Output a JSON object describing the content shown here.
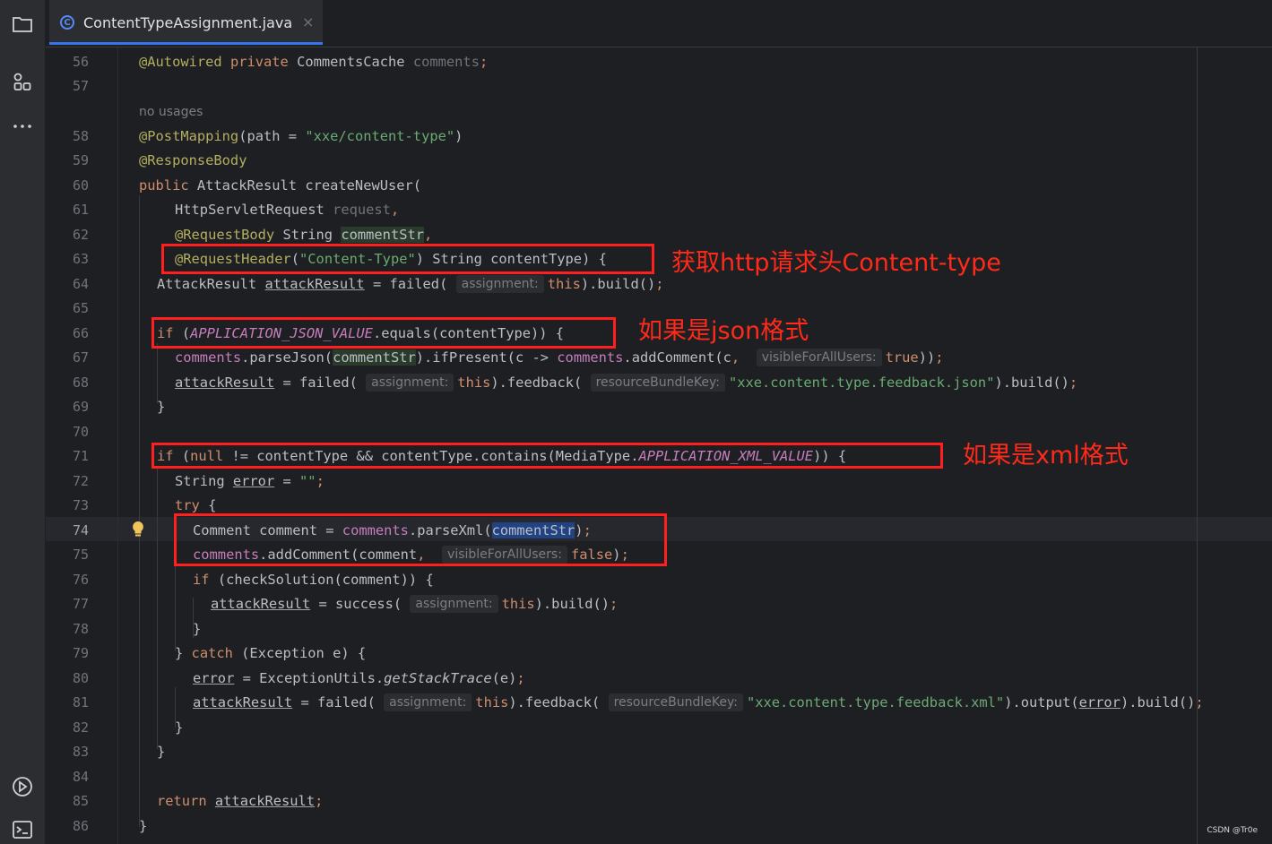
{
  "tab": {
    "icon_letter": "C",
    "title": "ContentTypeAssignment.java",
    "close_glyph": "×"
  },
  "sidebar": {
    "icons": [
      "folder-icon",
      "structure-icon",
      "more-icon",
      "run-icon",
      "terminal-icon"
    ]
  },
  "editor": {
    "current_line": 74,
    "lines": [
      {
        "n": 56,
        "code": "@Autowired private CommentsCache comments;"
      },
      {
        "n": 57,
        "code": ""
      },
      {
        "n": null,
        "code": "no usages"
      },
      {
        "n": 58,
        "code": "@PostMapping(path = \"xxe/content-type\")"
      },
      {
        "n": 59,
        "code": "@ResponseBody"
      },
      {
        "n": 60,
        "code": "public AttackResult createNewUser("
      },
      {
        "n": 61,
        "code": "HttpServletRequest request,"
      },
      {
        "n": 62,
        "code": "@RequestBody String commentStr,"
      },
      {
        "n": 63,
        "code": "@RequestHeader(\"Content-Type\") String contentType) {"
      },
      {
        "n": 64,
        "code": "AttackResult attackResult = failed( assignment: this).build();"
      },
      {
        "n": 65,
        "code": ""
      },
      {
        "n": 66,
        "code": "if (APPLICATION_JSON_VALUE.equals(contentType)) {"
      },
      {
        "n": 67,
        "code": "comments.parseJson(commentStr).ifPresent(c -> comments.addComment(c,  visibleForAllUsers: true));"
      },
      {
        "n": 68,
        "code": "attackResult = failed( assignment: this).feedback( resourceBundleKey: \"xxe.content.type.feedback.json\").build();"
      },
      {
        "n": 69,
        "code": "}"
      },
      {
        "n": 70,
        "code": ""
      },
      {
        "n": 71,
        "code": "if (null != contentType && contentType.contains(MediaType.APPLICATION_XML_VALUE)) {"
      },
      {
        "n": 72,
        "code": "String error = \"\";"
      },
      {
        "n": 73,
        "code": "try {"
      },
      {
        "n": 74,
        "code": "Comment comment = comments.parseXml(commentStr);"
      },
      {
        "n": 75,
        "code": "comments.addComment(comment,  visibleForAllUsers: false);"
      },
      {
        "n": 76,
        "code": "if (checkSolution(comment)) {"
      },
      {
        "n": 77,
        "code": "attackResult = success( assignment: this).build();"
      },
      {
        "n": 78,
        "code": "}"
      },
      {
        "n": 79,
        "code": "} catch (Exception e) {"
      },
      {
        "n": 80,
        "code": "error = ExceptionUtils.getStackTrace(e);"
      },
      {
        "n": 81,
        "code": "attackResult = failed( assignment: this).feedback( resourceBundleKey: \"xxe.content.type.feedback.xml\").output(error).build();"
      },
      {
        "n": 82,
        "code": "}"
      },
      {
        "n": 83,
        "code": "}"
      },
      {
        "n": 84,
        "code": ""
      },
      {
        "n": 85,
        "code": "return attackResult;"
      },
      {
        "n": 86,
        "code": "}"
      }
    ]
  },
  "annotations": {
    "header_note": "获取http请求头Content-type",
    "json_note": "如果是json格式",
    "xml_note": "如果是xml格式"
  },
  "colors": {
    "highlight_box": "#ff1f1f",
    "annotation_text": "#ff2a1a",
    "editor_bg": "#1e1f22",
    "keyword": "#cf8e6d",
    "string": "#6aab73",
    "annotation": "#b3ae60",
    "field": "#c77dbb"
  },
  "watermark": "CSDN @Tr0e"
}
